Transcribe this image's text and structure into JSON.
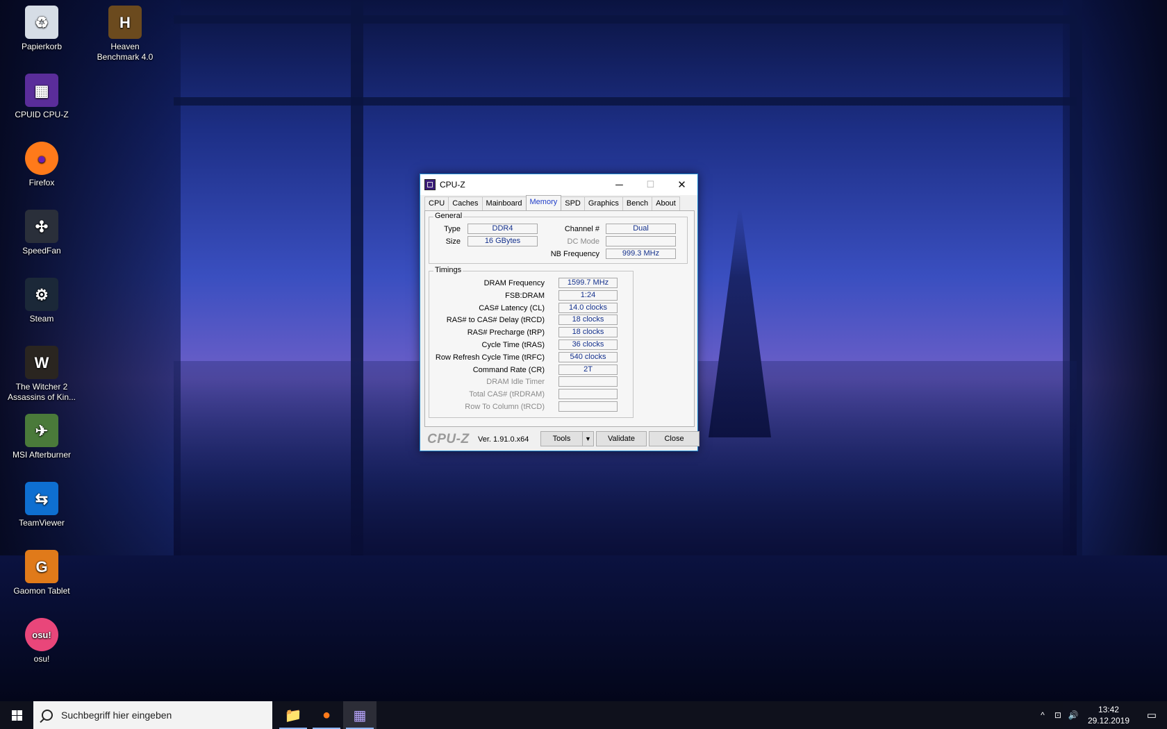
{
  "desktop": {
    "icons": [
      {
        "label": "Papierkorb",
        "icon": "recycle-bin-icon",
        "glyph": "♻",
        "color": "#d6dde6"
      },
      {
        "label": "Heaven Benchmark 4.0",
        "icon": "heaven-benchmark-icon",
        "glyph": "H",
        "color": "#6b4a1e"
      },
      {
        "label": "CPUID CPU-Z",
        "icon": "cpuz-icon",
        "glyph": "▦",
        "color": "#5a2d9a"
      },
      {
        "label": "Firefox",
        "icon": "firefox-icon",
        "glyph": "●",
        "color": "#ff7a1a"
      },
      {
        "label": "SpeedFan",
        "icon": "speedfan-icon",
        "glyph": "✣",
        "color": "#2a2f3a"
      },
      {
        "label": "Steam",
        "icon": "steam-icon",
        "glyph": "⚙",
        "color": "#1b2838"
      },
      {
        "label": "The Witcher 2 Assassins of Kin...",
        "icon": "witcher-icon",
        "glyph": "W",
        "color": "#2a2520"
      },
      {
        "label": "MSI Afterburner",
        "icon": "msi-afterburner-icon",
        "glyph": "✈",
        "color": "#4a7a3a"
      },
      {
        "label": "TeamViewer",
        "icon": "teamviewer-icon",
        "glyph": "⇆",
        "color": "#0e6fd1"
      },
      {
        "label": "Gaomon Tablet",
        "icon": "gaomon-icon",
        "glyph": "G",
        "color": "#e07a1a"
      },
      {
        "label": "osu!",
        "icon": "osu-icon",
        "glyph": "osu!",
        "color": "#e9467a"
      }
    ]
  },
  "window": {
    "title": "CPU-Z",
    "minimize": "─",
    "maximize": "☐",
    "close": "✕",
    "tabs": [
      "CPU",
      "Caches",
      "Mainboard",
      "Memory",
      "SPD",
      "Graphics",
      "Bench",
      "About"
    ],
    "active_tab": "Memory",
    "general": {
      "legend": "General",
      "type_label": "Type",
      "type_value": "DDR4",
      "size_label": "Size",
      "size_value": "16 GBytes",
      "channel_label": "Channel #",
      "channel_value": "Dual",
      "dcmode_label": "DC Mode",
      "dcmode_value": "",
      "nbfreq_label": "NB Frequency",
      "nbfreq_value": "999.3 MHz"
    },
    "timings": {
      "legend": "Timings",
      "rows": [
        {
          "label": "DRAM Frequency",
          "value": "1599.7 MHz",
          "dim": false
        },
        {
          "label": "FSB:DRAM",
          "value": "1:24",
          "dim": false
        },
        {
          "label": "CAS# Latency (CL)",
          "value": "14.0 clocks",
          "dim": false
        },
        {
          "label": "RAS# to CAS# Delay (tRCD)",
          "value": "18 clocks",
          "dim": false
        },
        {
          "label": "RAS# Precharge (tRP)",
          "value": "18 clocks",
          "dim": false
        },
        {
          "label": "Cycle Time (tRAS)",
          "value": "36 clocks",
          "dim": false
        },
        {
          "label": "Row Refresh Cycle Time (tRFC)",
          "value": "540 clocks",
          "dim": false
        },
        {
          "label": "Command Rate (CR)",
          "value": "2T",
          "dim": false
        },
        {
          "label": "DRAM Idle Timer",
          "value": "",
          "dim": true
        },
        {
          "label": "Total CAS# (tRDRAM)",
          "value": "",
          "dim": true
        },
        {
          "label": "Row To Column (tRCD)",
          "value": "",
          "dim": true
        }
      ]
    },
    "footer": {
      "brand": "CPU-Z",
      "version": "Ver. 1.91.0.x64",
      "tools": "Tools",
      "tools_arrow": "▼",
      "validate": "Validate",
      "close": "Close"
    }
  },
  "taskbar": {
    "search_placeholder": "Suchbegriff hier eingeben",
    "apps": [
      {
        "name": "file-explorer",
        "glyph": "📁",
        "active": false
      },
      {
        "name": "firefox",
        "glyph": "●",
        "active": false
      },
      {
        "name": "cpuz",
        "glyph": "▦",
        "active": true
      }
    ],
    "tray": {
      "chevron": "^",
      "network": "⊡",
      "volume": "🔊",
      "time": "13:42",
      "date": "29.12.2019",
      "notifications": "▭"
    }
  }
}
